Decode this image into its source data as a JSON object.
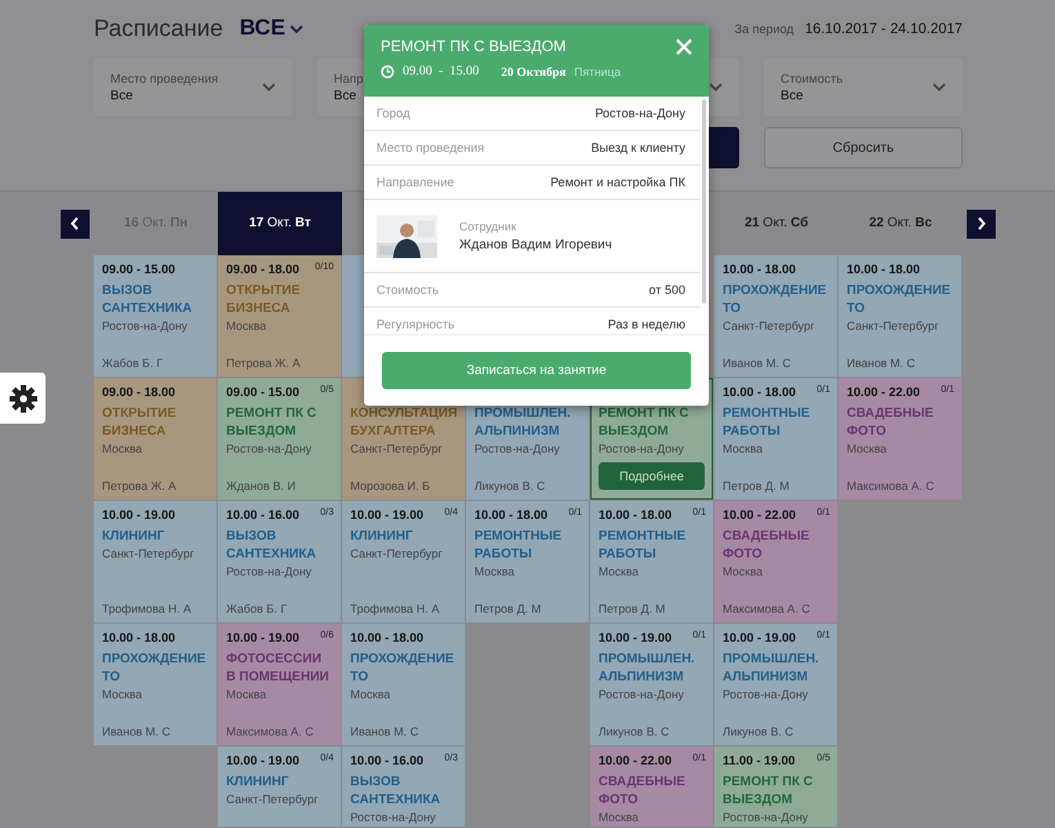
{
  "header": {
    "title": "Расписание",
    "filter_value": "ВСЕ",
    "period_label": "За период",
    "period": "16.10.2017 - 24.10.2017"
  },
  "filters": [
    {
      "kind": "dropdown",
      "label": "Место проведения",
      "value": "Все"
    },
    {
      "kind": "field",
      "label": "Напр",
      "value": "Все"
    },
    {
      "kind": "dropdown"
    },
    {
      "kind": "dropdown",
      "label": "Стоимость",
      "value": "Все"
    }
  ],
  "actions": [
    {
      "kind": "primary"
    },
    {
      "kind": "secondary",
      "label": "Сбросить"
    }
  ],
  "days": [
    {
      "label": "**16** Окт. **Пн**",
      "disabled": true,
      "selected": false,
      "cells": [
        {
          "time": "09.00 - 15.00",
          "title": "ВЫЗОВ САНТЕХНИКА",
          "city": "Ростов-на-Дону",
          "person": "Жабов Б. Г",
          "color": "#93a7b4",
          "selected": false
        },
        {
          "time": "09.00 - 18.00",
          "title": "ОТКРЫТИЕ БИЗНЕСА",
          "city": "Москва",
          "person": "Петрова Ж. А",
          "color": "#a8977f",
          "selected": false
        },
        {
          "time": "10.00 - 19.00",
          "title": "КЛИНИНГ",
          "city": "Санкт-Петербург",
          "person": "Трофимова Н. А",
          "color": "#93a7b4",
          "selected": false
        },
        {
          "time": "10.00 - 18.00",
          "title": "ПРОХОЖДЕНИЕ ТО",
          "city": "Москва",
          "person": "Иванов М. С",
          "color": "#93a7b4",
          "selected": false
        }
      ]
    },
    {
      "label": "**17** Окт. **Вт**",
      "disabled": false,
      "selected": true,
      "cells": [
        {
          "time": "09.00 - 18.00",
          "count": "0/10",
          "title": "ОТКРЫТИЕ БИЗНЕСА",
          "city": "Москва",
          "person": "Петрова Ж. А",
          "color": "#a8977f",
          "selected": false
        },
        {
          "time": "09.00 - 15.00",
          "count": "0/5",
          "title": "РЕМОНТ ПК С ВЫЕЗДОМ",
          "city": "Ростов-на-Дону",
          "person": "Жданов В. И",
          "color": "#8fab98",
          "selected": false
        },
        {
          "time": "10.00 - 16.00",
          "count": "0/3",
          "title": "ВЫЗОВ САНТЕХНИКА",
          "city": "Ростов-на-Дону",
          "person": "Жабов Б. Г",
          "color": "#93a7b4",
          "selected": false
        },
        {
          "time": "10.00 - 19.00",
          "count": "0/6",
          "title": "ФОТОСЕССИИ В ПОМЕЩЕНИИ",
          "city": "Москва",
          "person": "Максимова А. С",
          "color": "#a68aa4",
          "selected": false
        },
        {
          "time": "10.00 - 19.00",
          "count": "0/4",
          "title": "КЛИНИНГ",
          "city": "Санкт-Петербург",
          "color": "#93a7b4",
          "selected": false
        }
      ]
    },
    {
      "selected": false,
      "cells": [
        {
          "color": "#93a7b4",
          "selected": false
        },
        {
          "title": "КОНСУЛЬТАЦИЯ БУХГАЛТЕРА",
          "city": "Санкт-Петербург",
          "person": "Морозова И. Б",
          "color": "#a8977f",
          "selected": false
        },
        {
          "time": "10.00 - 19.00",
          "count": "0/4",
          "title": "КЛИНИНГ",
          "city": "Санкт-Петербург",
          "person": "Трофимова Н. А",
          "color": "#93a7b4",
          "selected": false
        },
        {
          "time": "10.00 - 18.00",
          "title": "ПРОХОЖДЕНИЕ ТО",
          "city": "Москва",
          "person": "Иванов М. С",
          "color": "#93a7b4",
          "selected": false
        },
        {
          "time": "10.00 - 16.00",
          "count": "0/3",
          "title": "ВЫЗОВ САНТЕХНИКА",
          "city": "Ростов-на-Дону",
          "color": "#93a7b4",
          "selected": false
        }
      ]
    },
    {
      "cells": [
        {},
        {
          "title": "ПРОМЫШЛЕН. АЛЬПИНИЗМ",
          "city": "Ростов-на-Дону",
          "person": "Ликунов В. С",
          "color": "#93a7b4",
          "selected": false
        },
        {
          "time": "10.00 - 18.00",
          "count": "0/1",
          "title": "РЕМОНТНЫЕ РАБОТЫ",
          "city": "Москва",
          "person": "Петров Д. М",
          "color": "#93a7b4",
          "selected": false
        }
      ]
    },
    {
      "selected": false,
      "cells": [
        {},
        {
          "title": "РЕМОНТ ПК С ВЫЕЗДОМ",
          "city": "Ростов-на-Дону",
          "button": "Подробнее",
          "color": "#8fab98",
          "selected": true
        },
        {
          "time": "10.00 - 18.00",
          "count": "0/1",
          "title": "РЕМОНТНЫЕ РАБОТЫ",
          "city": "Москва",
          "person": "Петров Д. М",
          "color": "#93a7b4",
          "selected": false
        },
        {
          "time": "10.00 - 19.00",
          "count": "0/1",
          "title": "ПРОМЫШЛЕН. АЛЬПИНИЗМ",
          "city": "Ростов-на-Дону",
          "person": "Ликунов В. С",
          "color": "#93a7b4",
          "selected": false
        },
        {
          "time": "10.00 - 22.00",
          "count": "0/1",
          "title": "СВАДЕБНЫЕ ФОТО",
          "city": "Москва",
          "color": "#a68aa4",
          "selected": false
        }
      ]
    },
    {
      "label": "**21** Окт. **Сб**",
      "disabled": false,
      "selected": false,
      "cells": [
        {
          "time": "10.00 - 18.00",
          "title": "ПРОХОЖДЕНИЕ ТО",
          "city": "Санкт-Петербург",
          "person": "Иванов М. С",
          "color": "#93a7b4",
          "selected": false
        },
        {
          "time": "10.00 - 18.00",
          "count": "0/1",
          "title": "РЕМОНТНЫЕ РАБОТЫ",
          "city": "Москва",
          "person": "Петров Д. М",
          "color": "#93a7b4",
          "selected": false
        },
        {
          "time": "10.00 - 22.00",
          "count": "0/1",
          "title": "СВАДЕБНЫЕ ФОТО",
          "city": "Москва",
          "person": "Максимова А. С",
          "color": "#a68aa4",
          "selected": false
        },
        {
          "time": "10.00 - 19.00",
          "count": "0/1",
          "title": "ПРОМЫШЛЕН. АЛЬПИНИЗМ",
          "city": "Ростов-на-Дону",
          "person": "Ликунов В. С",
          "color": "#93a7b4",
          "selected": false
        },
        {
          "time": "11.00 - 19.00",
          "count": "0/5",
          "title": "РЕМОНТ ПК С ВЫЕЗДОМ",
          "city": "Ростов-на-Дону",
          "color": "#8fab98",
          "selected": false
        }
      ]
    },
    {
      "label": "**22** Окт. **Вс**",
      "disabled": false,
      "selected": false,
      "cells": [
        {
          "time": "10.00 - 18.00",
          "title": "ПРОХОЖДЕНИЕ ТО",
          "city": "Санкт-Петербург",
          "person": "Иванов М. С",
          "color": "#93a7b4",
          "selected": false
        },
        {
          "time": "10.00 - 22.00",
          "count": "0/1",
          "title": "СВАДЕБНЫЕ ФОТО",
          "city": "Москва",
          "person": "Максимова А. С",
          "color": "#a68aa4",
          "selected": false
        }
      ]
    }
  ],
  "popup": {
    "title": "РЕМОНТ ПК С ВЫЕЗДОМ",
    "time": "09.00  -  15.00",
    "date": "20 Октября",
    "weekday": "Пятница",
    "details": [
      {
        "kind": "field",
        "label": "Город",
        "value": "Ростов-на-Дону"
      },
      {
        "kind": "field",
        "label": "Место проведения",
        "value": "Выезд к клиенту"
      },
      {
        "kind": "field",
        "label": "Направление",
        "value": "Ремонт и настройка ПК"
      },
      {
        "kind": "employee",
        "label": "Сотрудник",
        "value": "Жданов Вадим Игоревич"
      },
      {
        "kind": "field",
        "label": "Стоимость",
        "value": "от 500"
      },
      {
        "kind": "field",
        "label": "Регулярность",
        "value": "Раз в неделю"
      }
    ],
    "button": "Записаться на занятие"
  }
}
